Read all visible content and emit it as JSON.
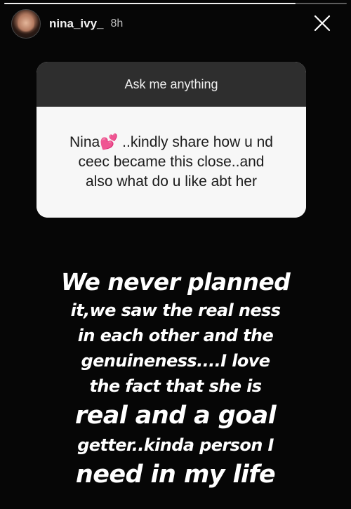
{
  "story": {
    "progress": 0.85
  },
  "header": {
    "username": "nina_ivy_",
    "time": "8h",
    "close_icon": "close-icon"
  },
  "question_sticker": {
    "title": "Ask me anything",
    "question_line1": "Nina💕 ..kindly share how u  nd",
    "question_line2": "ceec became this close..and",
    "question_line3": "also what do u like abt her"
  },
  "answer": {
    "line1": "We never planned",
    "line2": "it,we saw the real ness",
    "line3": "in each other and the",
    "line4": "genuineness....I love",
    "line5": "the fact that she is",
    "line6": "real and a goal",
    "line7": "getter..kinda person I",
    "line8": "need in my life"
  },
  "colors": {
    "background": "#050505",
    "card_header": "#2e2e2e",
    "card_body": "#f7f7f7",
    "text": "#ffffff"
  }
}
